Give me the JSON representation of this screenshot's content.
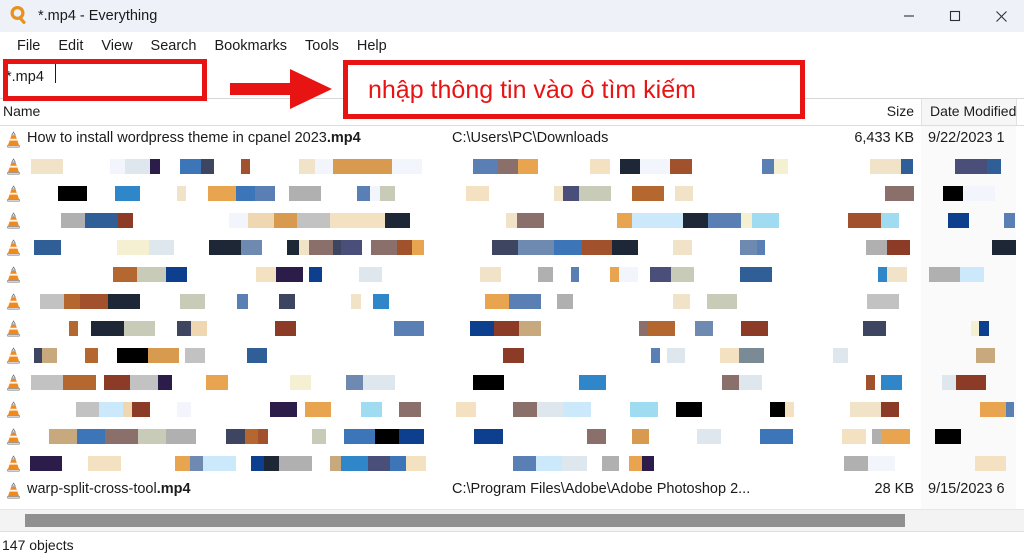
{
  "window": {
    "title": "*.mp4 - Everything",
    "app_icon": "magnifier-icon",
    "controls": {
      "minimize": "minimize-icon",
      "maximize": "maximize-icon",
      "close": "close-icon"
    }
  },
  "menubar": {
    "items": [
      {
        "label": "File"
      },
      {
        "label": "Edit"
      },
      {
        "label": "View"
      },
      {
        "label": "Search"
      },
      {
        "label": "Bookmarks"
      },
      {
        "label": "Tools"
      },
      {
        "label": "Help"
      }
    ]
  },
  "search": {
    "value": "*.mp4",
    "placeholder": ""
  },
  "columns": {
    "name": "Name",
    "size": "Size",
    "date_modified": "Date Modified"
  },
  "annotation": {
    "text": "nhập thông tin vào ô tìm kiếm",
    "color": "#e81313",
    "arrow": "right-arrow-icon"
  },
  "rows": [
    {
      "icon": "vlc-media-file-icon",
      "name_main": "How to install wordpress theme in cpanel 2023",
      "name_ext": ".mp4",
      "path": "C:\\Users\\PC\\Downloads",
      "size": "6,433 KB",
      "date": "9/22/2023 1",
      "redacted": false
    },
    {
      "icon": "vlc-media-file-icon",
      "redacted": true
    },
    {
      "icon": "vlc-media-file-icon",
      "redacted": true
    },
    {
      "icon": "vlc-media-file-icon",
      "redacted": true
    },
    {
      "icon": "vlc-media-file-icon",
      "redacted": true
    },
    {
      "icon": "vlc-media-file-icon",
      "redacted": true
    },
    {
      "icon": "vlc-media-file-icon",
      "redacted": true
    },
    {
      "icon": "vlc-media-file-icon",
      "redacted": true
    },
    {
      "icon": "vlc-media-file-icon",
      "redacted": true
    },
    {
      "icon": "vlc-media-file-icon",
      "redacted": true
    },
    {
      "icon": "vlc-media-file-icon",
      "redacted": true
    },
    {
      "icon": "vlc-media-file-icon",
      "redacted": true
    },
    {
      "icon": "vlc-media-file-icon",
      "redacted": true
    },
    {
      "icon": "vlc-media-file-icon",
      "name_main": "warp-split-cross-tool",
      "name_ext": ".mp4",
      "path": "C:\\Program Files\\Adobe\\Adobe Photoshop 2...",
      "size": "28 KB",
      "date": "9/15/2023 6",
      "redacted": false
    }
  ],
  "statusbar": {
    "text": "147 objects"
  },
  "scrollbar": {
    "orientation": "horizontal"
  }
}
